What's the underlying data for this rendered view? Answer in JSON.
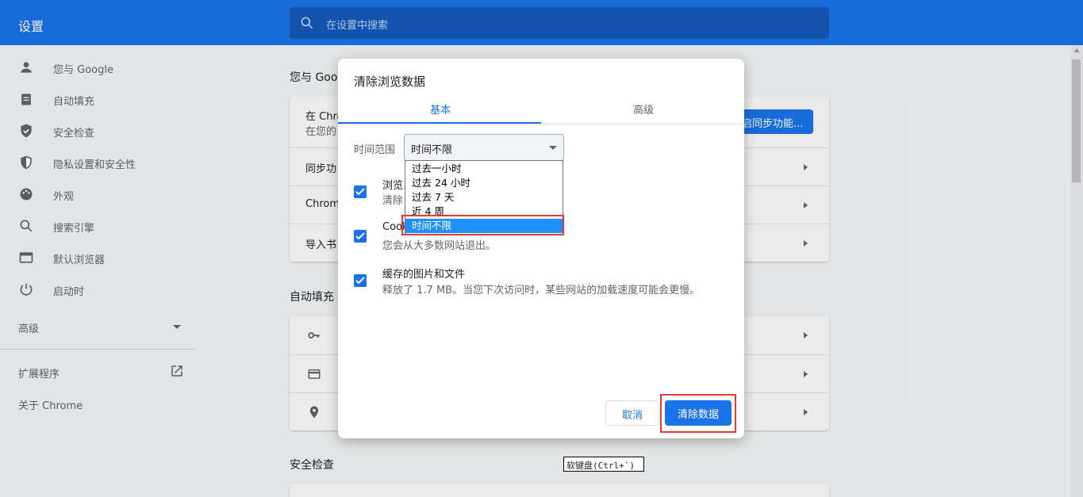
{
  "header": {
    "title": "设置",
    "search_placeholder": "在设置中搜索"
  },
  "sidebar": {
    "items": [
      {
        "label": "您与 Google",
        "icon": "person-icon"
      },
      {
        "label": "自动填充",
        "icon": "clipboard-icon"
      },
      {
        "label": "安全检查",
        "icon": "shield-check-icon"
      },
      {
        "label": "隐私设置和安全性",
        "icon": "shield-half-icon"
      },
      {
        "label": "外观",
        "icon": "palette-icon"
      },
      {
        "label": "搜索引擎",
        "icon": "search-icon"
      },
      {
        "label": "默认浏览器",
        "icon": "browser-icon"
      },
      {
        "label": "启动时",
        "icon": "power-icon"
      }
    ],
    "advanced": "高级",
    "extensions": "扩展程序",
    "about": "关于 Chrome"
  },
  "main": {
    "you_and_google_title": "您与 Goo",
    "sync_row_line1": "在 Chro",
    "sync_row_line2": "在您的",
    "sync_button": "启同步功能...",
    "row_sync": "同步功",
    "row_chrome": "Chrome",
    "row_import": "导入书",
    "autofill_title": "自动填充",
    "safety_title": "安全检查"
  },
  "dialog": {
    "title": "清除浏览数据",
    "tabs": [
      "基本",
      "高级"
    ],
    "time_range_label": "时间范围",
    "time_range_value": "时间不限",
    "options": [
      "过去一小时",
      "过去 24 小时",
      "过去 7 天",
      "近 4 周",
      "时间不限"
    ],
    "items": [
      {
        "title": "浏览",
        "sub": "清除"
      },
      {
        "title": "Cook",
        "sub": "您会从大多数网站退出。"
      },
      {
        "title": "缓存的图片和文件",
        "sub": "释放了 1.7 MB。当您下次访问时，某些网站的加载速度可能会更慢。"
      }
    ],
    "cancel": "取消",
    "clear": "清除数据"
  },
  "ime_hint": "软键盘(Ctrl+`)",
  "colors": {
    "accent": "#1a73e8",
    "highlight": "#e53935"
  }
}
